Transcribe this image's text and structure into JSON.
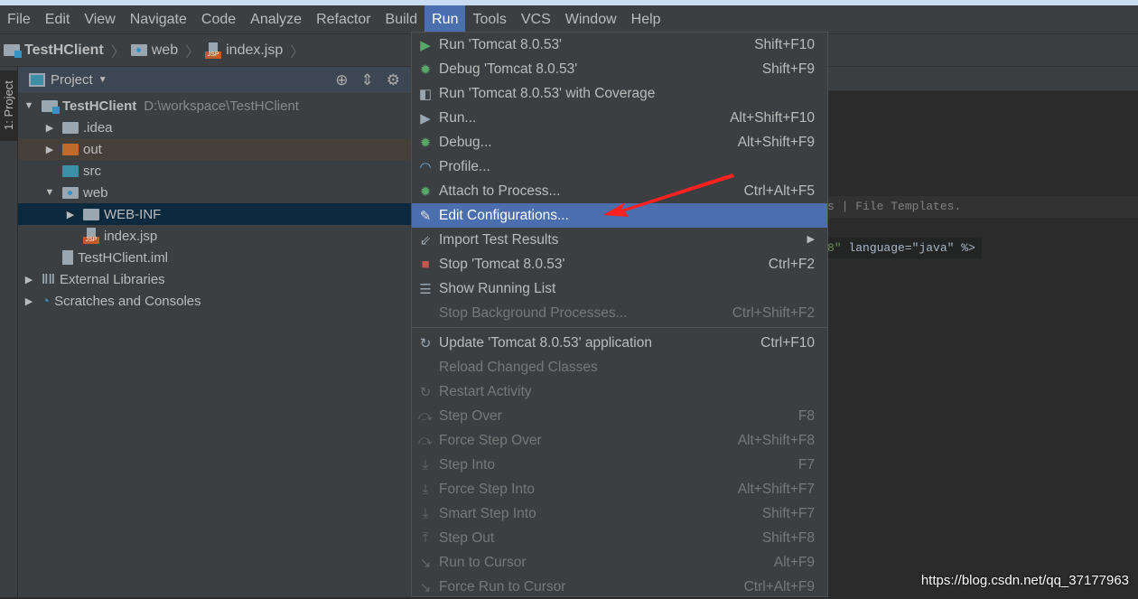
{
  "menubar": [
    "File",
    "Edit",
    "View",
    "Navigate",
    "Code",
    "Analyze",
    "Refactor",
    "Build",
    "Run",
    "Tools",
    "VCS",
    "Window",
    "Help"
  ],
  "active_menu": "Run",
  "breadcrumb": [
    "TestHClient",
    "web",
    "index.jsp"
  ],
  "side_tab": "1: Project",
  "project_panel": {
    "title": "Project",
    "icons": [
      "locate-icon",
      "collapse-all-icon",
      "gear-icon"
    ]
  },
  "tree": [
    {
      "label": "TestHClient",
      "path": "D:\\workspace\\TestHClient",
      "depth": 0,
      "arrow": "▼",
      "icon": "module",
      "bold": true
    },
    {
      "label": ".idea",
      "depth": 1,
      "arrow": "▶",
      "icon": "folder"
    },
    {
      "label": "out",
      "depth": 1,
      "arrow": "▶",
      "icon": "folder-orange",
      "state": "hl"
    },
    {
      "label": "src",
      "depth": 1,
      "arrow": "",
      "icon": "folder-teal"
    },
    {
      "label": "web",
      "depth": 1,
      "arrow": "▼",
      "icon": "folder-web"
    },
    {
      "label": "WEB-INF",
      "depth": 2,
      "arrow": "▶",
      "icon": "folder",
      "state": "sel"
    },
    {
      "label": "index.jsp",
      "depth": 2,
      "arrow": "",
      "icon": "jsp"
    },
    {
      "label": "TestHClient.iml",
      "depth": 1,
      "arrow": "",
      "icon": "file"
    },
    {
      "label": "External Libraries",
      "depth": 0,
      "arrow": "▶",
      "icon": "libraries"
    },
    {
      "label": "Scratches and Consoles",
      "depth": 0,
      "arrow": "▶",
      "icon": "scratches"
    }
  ],
  "editor": {
    "hint": "s | File Templates.",
    "code_prefix": "8\"",
    "code_rest": " language=\"java\" %>"
  },
  "run_menu": [
    {
      "label": "Run 'Tomcat 8.0.53'",
      "shortcut": "Shift+F10",
      "icon": "run-icon",
      "color": "#59a869"
    },
    {
      "label": "Debug 'Tomcat 8.0.53'",
      "shortcut": "Shift+F9",
      "icon": "debug-icon",
      "color": "#59a869"
    },
    {
      "label": "Run 'Tomcat 8.0.53' with Coverage",
      "shortcut": "",
      "icon": "coverage-icon",
      "color": "#9aa7b0"
    },
    {
      "label": "Run...",
      "shortcut": "Alt+Shift+F10",
      "icon": "run-dialog-icon",
      "color": "#9aa7b0"
    },
    {
      "label": "Debug...",
      "shortcut": "Alt+Shift+F9",
      "icon": "debug-icon",
      "color": "#59a869"
    },
    {
      "label": "Profile...",
      "shortcut": "",
      "icon": "profile-icon",
      "color": "#6ba8d8"
    },
    {
      "label": "Attach to Process...",
      "shortcut": "Ctrl+Alt+F5",
      "icon": "attach-icon",
      "color": "#59a869"
    },
    {
      "label": "Edit Configurations...",
      "shortcut": "",
      "icon": "pencil-icon",
      "color": "#ddd",
      "selected": true
    },
    {
      "label": "Import Test Results",
      "shortcut": "",
      "icon": "import-icon",
      "color": "#9aa7b0",
      "submenu": true
    },
    {
      "label": "Stop 'Tomcat 8.0.53'",
      "shortcut": "Ctrl+F2",
      "icon": "stop-icon",
      "color": "#c75450"
    },
    {
      "label": "Show Running List",
      "shortcut": "",
      "icon": "list-icon",
      "color": "#9aa7b0"
    },
    {
      "label": "Stop Background Processes...",
      "shortcut": "Ctrl+Shift+F2",
      "icon": "",
      "disabled": true,
      "separator_after": true
    },
    {
      "label": "Update 'Tomcat 8.0.53' application",
      "shortcut": "Ctrl+F10",
      "icon": "refresh-icon",
      "color": "#9aa7b0"
    },
    {
      "label": "Reload Changed Classes",
      "shortcut": "",
      "icon": "",
      "disabled": true
    },
    {
      "label": "Restart Activity",
      "shortcut": "",
      "icon": "restart-icon",
      "disabled": true
    },
    {
      "label": "Step Over",
      "shortcut": "F8",
      "icon": "step-over-icon",
      "disabled": true
    },
    {
      "label": "Force Step Over",
      "shortcut": "Alt+Shift+F8",
      "icon": "force-step-over-icon",
      "disabled": true
    },
    {
      "label": "Step Into",
      "shortcut": "F7",
      "icon": "step-into-icon",
      "disabled": true
    },
    {
      "label": "Force Step Into",
      "shortcut": "Alt+Shift+F7",
      "icon": "force-step-into-icon",
      "disabled": true
    },
    {
      "label": "Smart Step Into",
      "shortcut": "Shift+F7",
      "icon": "smart-step-into-icon",
      "disabled": true
    },
    {
      "label": "Step Out",
      "shortcut": "Shift+F8",
      "icon": "step-out-icon",
      "disabled": true
    },
    {
      "label": "Run to Cursor",
      "shortcut": "Alt+F9",
      "icon": "run-to-cursor-icon",
      "disabled": true
    },
    {
      "label": "Force Run to Cursor",
      "shortcut": "Ctrl+Alt+F9",
      "icon": "force-run-to-cursor-icon",
      "disabled": true
    }
  ],
  "watermark": "https://blog.csdn.net/qq_37177963",
  "colors": {
    "selection": "#4b6eaf",
    "annotation_arrow": "#ff2020"
  }
}
